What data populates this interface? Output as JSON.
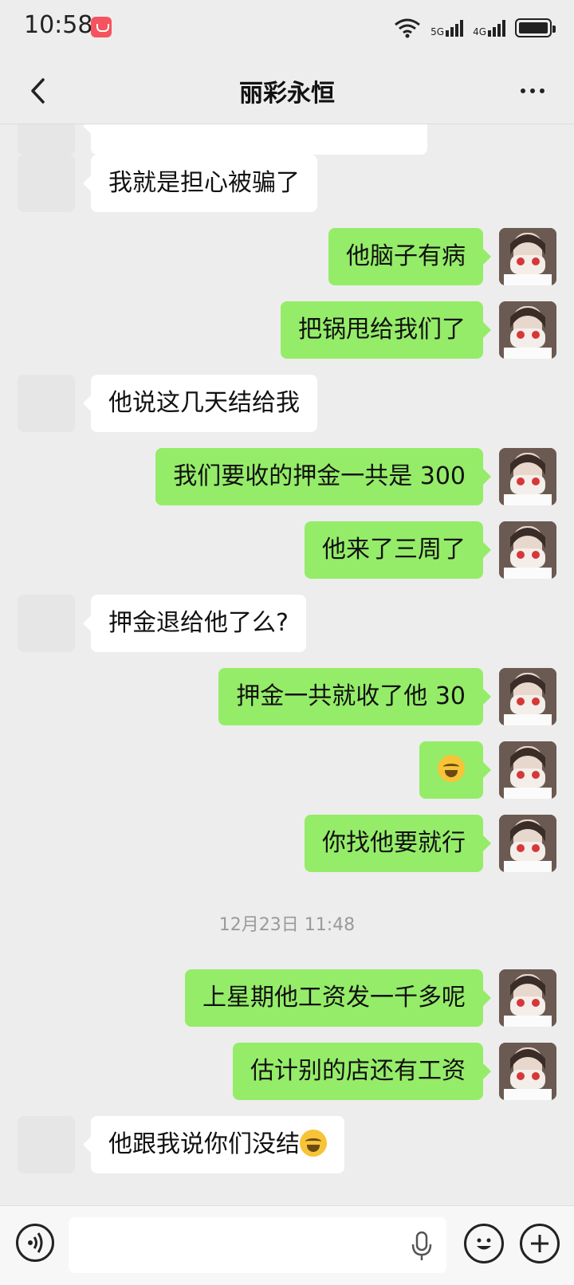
{
  "status_bar": {
    "time": "10:58",
    "network_5g": "5G",
    "network_4g": "4G",
    "icons": [
      "app-notification-icon",
      "wifi-icon",
      "signal-5g-icon",
      "signal-4g-icon",
      "battery-icon"
    ]
  },
  "nav": {
    "title": "丽彩永恒",
    "back_icon": "chevron-left-icon",
    "more_icon": "more-dots-icon"
  },
  "messages": [
    {
      "side": "in",
      "text": "我就是担心被骗了"
    },
    {
      "side": "out",
      "text": "他脑子有病"
    },
    {
      "side": "out",
      "text": "把锅甩给我们了"
    },
    {
      "side": "in",
      "text": "他说这几天结给我"
    },
    {
      "side": "out",
      "text": "我们要收的押金一共是 300"
    },
    {
      "side": "out",
      "text": "他来了三周了"
    },
    {
      "side": "in",
      "text": "押金退给他了么?"
    },
    {
      "side": "out",
      "text": "押金一共就收了他 30"
    },
    {
      "side": "out",
      "text": "",
      "emoji": "laughing-crying-emoji"
    },
    {
      "side": "out",
      "text": "你找他要就行"
    },
    {
      "side": "out",
      "text": "上星期他工资发一千多呢"
    },
    {
      "side": "out",
      "text": "估计别的店还有工资"
    },
    {
      "side": "in",
      "text": "他跟我说你们没结",
      "emoji": "laughing-crying-emoji"
    }
  ],
  "timestamp": "12月23日 11:48",
  "input_bar": {
    "voice_icon": "voice-icon",
    "mic_icon": "microphone-icon",
    "emoji_icon": "emoji-icon",
    "plus_icon": "plus-icon",
    "value": ""
  },
  "colors": {
    "background": "#ededed",
    "outgoing_bubble": "#95ec69",
    "incoming_bubble": "#ffffff"
  }
}
